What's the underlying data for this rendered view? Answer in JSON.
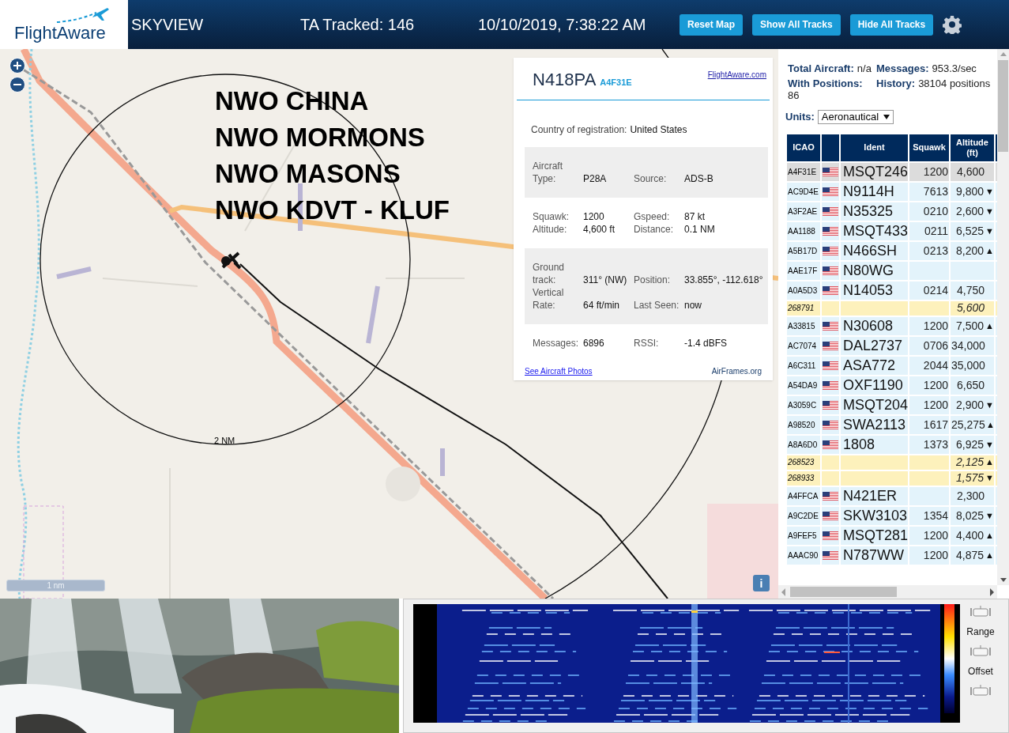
{
  "header": {
    "logo": "FlightAware",
    "title": "SKYVIEW",
    "tracked": "TA Tracked: 146",
    "datetime": "10/10/2019, 7:38:22 AM",
    "buttons": [
      "Reset Map",
      "Show All Tracks",
      "Hide All Tracks"
    ]
  },
  "map": {
    "overlay_text": [
      "NWO CHINA",
      "NWO MORMONS",
      "NWO MASONS",
      "NWO KDVT - KLUF"
    ],
    "range_label": "2 NM",
    "scale": "1 nm",
    "info_button": "i"
  },
  "popup": {
    "ident": "N418PA",
    "hex": "A4F31E",
    "link": "FlightAware.com",
    "country_label": "Country of registration:",
    "country": "United States",
    "sections": [
      {
        "shaded": true,
        "rows": [
          [
            {
              "label": "Aircraft Type:",
              "value": "P28A"
            },
            {
              "label": "Source:",
              "value": "ADS-B"
            }
          ]
        ]
      },
      {
        "shaded": false,
        "rows": [
          [
            {
              "label": "Squawk:",
              "value": "1200"
            },
            {
              "label": "Gspeed:",
              "value": "87 kt"
            }
          ],
          [
            {
              "label": "Altitude:",
              "value": "4,600 ft"
            },
            {
              "label": "Distance:",
              "value": "0.1 NM"
            }
          ]
        ]
      },
      {
        "shaded": true,
        "rows": [
          [
            {
              "label": "Ground track:",
              "value": "311° (NW)"
            },
            {
              "label": "Position:",
              "value": "33.855°, -112.618°"
            }
          ],
          [
            {
              "label": "Vertical Rate:",
              "value": "64 ft/min"
            },
            {
              "label": "Last Seen:",
              "value": "now"
            }
          ]
        ]
      },
      {
        "shaded": false,
        "rows": [
          [
            {
              "label": "Messages:",
              "value": "6896"
            },
            {
              "label": "RSSI:",
              "value": "-1.4 dBFS"
            }
          ]
        ]
      }
    ],
    "photos_link": "See Aircraft Photos",
    "airframes_link": "AirFrames.org"
  },
  "stats": [
    {
      "label": "Total Aircraft:",
      "value": "n/a"
    },
    {
      "label": "Messages:",
      "value": "953.3/sec"
    },
    {
      "label": "With Positions:",
      "value": "86"
    },
    {
      "label": "History:",
      "value": "38104 positions"
    }
  ],
  "units": {
    "label": "Units:",
    "value": "Aeronautical"
  },
  "table": {
    "columns": [
      "ICAO",
      "",
      "Ident",
      "Squawk",
      "Altitude (ft)"
    ],
    "rows": [
      {
        "kind": "aircraft",
        "selected": true,
        "icao": "A4F31E",
        "flag": true,
        "ident": "MSQT246",
        "squawk": "1200",
        "altitude": "4,600"
      },
      {
        "kind": "aircraft",
        "selected": false,
        "icao": "AC9D4E",
        "flag": true,
        "ident": "N9114H",
        "squawk": "7613",
        "altitude": "9,800",
        "trend": "▼"
      },
      {
        "kind": "aircraft",
        "selected": false,
        "icao": "A3F2AE",
        "flag": true,
        "ident": "N35325",
        "squawk": "0210",
        "altitude": "2,600",
        "trend": "▼"
      },
      {
        "kind": "aircraft",
        "selected": false,
        "icao": "AA1188",
        "flag": true,
        "ident": "MSQT433",
        "squawk": "0211",
        "altitude": "6,525",
        "trend": "▼"
      },
      {
        "kind": "aircraft",
        "selected": false,
        "icao": "A5B17D",
        "flag": true,
        "ident": "N466SH",
        "squawk": "0213",
        "altitude": "8,200",
        "trend": "▲"
      },
      {
        "kind": "aircraft",
        "selected": false,
        "icao": "AAE17F",
        "flag": true,
        "ident": "N80WG"
      },
      {
        "kind": "aircraft",
        "selected": false,
        "icao": "A0A5D3",
        "flag": true,
        "ident": "N14053",
        "squawk": "0214",
        "altitude": "4,750"
      },
      {
        "kind": "tisb",
        "selected": false,
        "icao": "268791",
        "flag": false,
        "altitude": "5,600"
      },
      {
        "kind": "aircraft",
        "selected": false,
        "icao": "A33815",
        "flag": true,
        "ident": "N30608",
        "squawk": "1200",
        "altitude": "7,500",
        "trend": "▲"
      },
      {
        "kind": "aircraft",
        "selected": false,
        "icao": "AC7074",
        "flag": true,
        "ident": "DAL2737",
        "squawk": "0706",
        "altitude": "34,000"
      },
      {
        "kind": "aircraft",
        "selected": false,
        "icao": "A6C311",
        "flag": true,
        "ident": "ASA772",
        "squawk": "2044",
        "altitude": "35,000"
      },
      {
        "kind": "aircraft",
        "selected": false,
        "icao": "A54DA9",
        "flag": true,
        "ident": "OXF1190",
        "squawk": "1200",
        "altitude": "6,650"
      },
      {
        "kind": "aircraft",
        "selected": false,
        "icao": "A3059C",
        "flag": true,
        "ident": "MSQT204",
        "squawk": "1200",
        "altitude": "2,900",
        "trend": "▼"
      },
      {
        "kind": "aircraft",
        "selected": false,
        "icao": "A98520",
        "flag": true,
        "ident": "SWA2113",
        "squawk": "1617",
        "altitude": "25,275",
        "trend": "▲"
      },
      {
        "kind": "aircraft",
        "selected": false,
        "icao": "A8A6D0",
        "flag": true,
        "ident": "1808",
        "squawk": "1373",
        "altitude": "6,925",
        "trend": "▼"
      },
      {
        "kind": "tisb",
        "selected": false,
        "icao": "268523",
        "flag": false,
        "altitude": "2,125",
        "trend": "▲"
      },
      {
        "kind": "tisb",
        "selected": false,
        "icao": "268933",
        "flag": false,
        "altitude": "1,575",
        "trend": "▼"
      },
      {
        "kind": "aircraft",
        "selected": false,
        "icao": "A4FFCA",
        "flag": true,
        "ident": "N421ER",
        "altitude": "2,300"
      },
      {
        "kind": "aircraft",
        "selected": false,
        "icao": "A9C2DE",
        "flag": true,
        "ident": "SKW3103",
        "squawk": "1354",
        "altitude": "8,025",
        "trend": "▼"
      },
      {
        "kind": "aircraft",
        "selected": false,
        "icao": "A9FEF5",
        "flag": true,
        "ident": "MSQT281",
        "squawk": "1200",
        "altitude": "4,400",
        "trend": "▲"
      },
      {
        "kind": "aircraft",
        "selected": false,
        "icao": "AAAC90",
        "flag": true,
        "ident": "N787WW",
        "squawk": "1200",
        "altitude": "4,875",
        "trend": "▲"
      }
    ]
  },
  "waterfall": {
    "labels": [
      "Range",
      "Offset"
    ]
  }
}
